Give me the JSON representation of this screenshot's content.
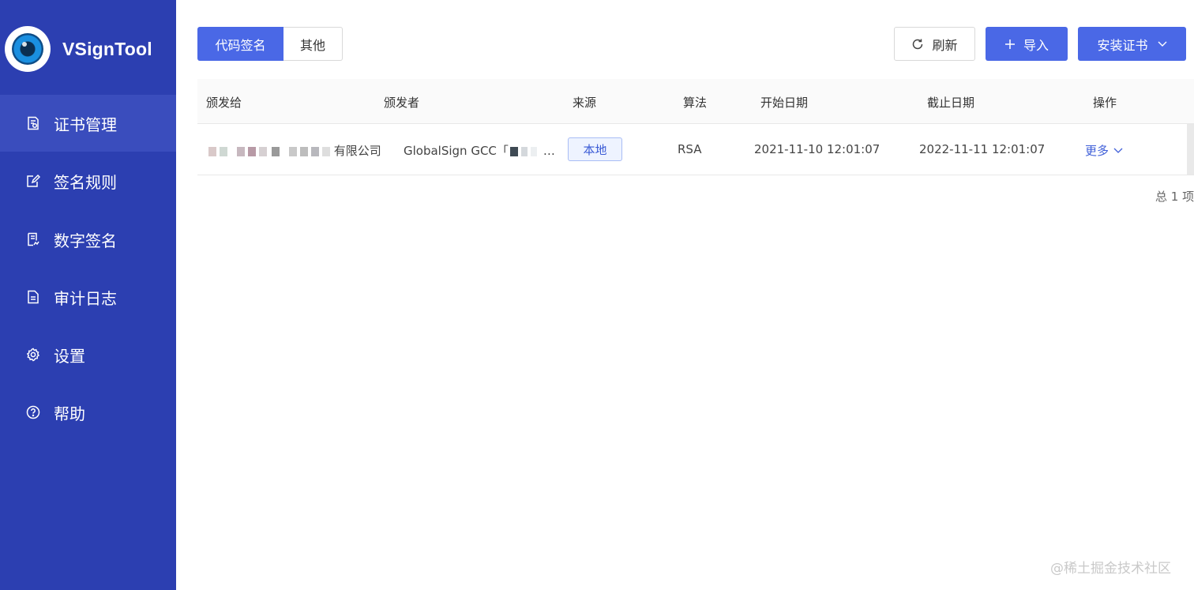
{
  "brand": {
    "name": "VSignTool"
  },
  "sidebar": {
    "items": [
      {
        "label": "证书管理",
        "icon": "certificate-icon",
        "active": true
      },
      {
        "label": "签名规则",
        "icon": "edit-icon",
        "active": false
      },
      {
        "label": "数字签名",
        "icon": "signature-icon",
        "active": false
      },
      {
        "label": "审计日志",
        "icon": "document-icon",
        "active": false
      },
      {
        "label": "设置",
        "icon": "gear-icon",
        "active": false
      },
      {
        "label": "帮助",
        "icon": "help-icon",
        "active": false
      }
    ]
  },
  "tabs": [
    {
      "label": "代码签名",
      "active": true
    },
    {
      "label": "其他",
      "active": false
    }
  ],
  "toolbar": {
    "refresh_label": "刷新",
    "import_label": "导入",
    "install_label": "安装证书"
  },
  "table": {
    "columns": [
      "颁发给",
      "颁发者",
      "来源",
      "算法",
      "开始日期",
      "截止日期",
      "操作"
    ],
    "rows": [
      {
        "issued_to_suffix": "有限公司",
        "issuer": "GlobalSign GCC「",
        "issuer_suffix": "…",
        "source": "本地",
        "algorithm": "RSA",
        "start_date": "2021-11-10 12:01:07",
        "end_date": "2022-11-11 12:01:07",
        "action": "更多"
      }
    ]
  },
  "pagination": {
    "total": "总 1 项"
  },
  "watermark": "@稀土掘金技术社区",
  "colors": {
    "sidebar": "#2c3fb1",
    "sidebar_active": "#3a4dbd",
    "primary": "#4a68e6",
    "link": "#3f5fd8"
  }
}
